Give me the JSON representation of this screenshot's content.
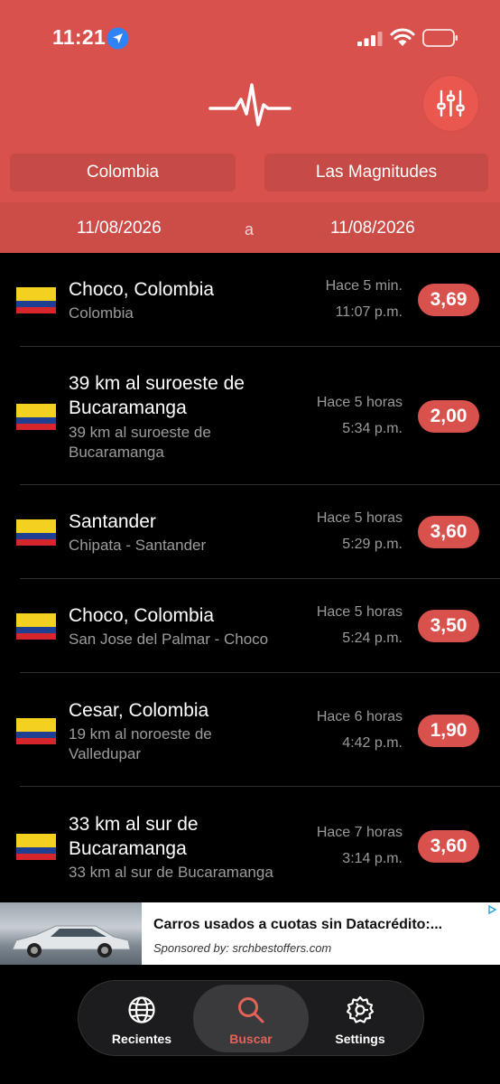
{
  "status_bar": {
    "time": "11:21"
  },
  "header": {
    "logo_icon": "heartbeat-icon",
    "filter_icon": "sliders-icon",
    "country_selector": "Colombia",
    "magnitude_selector": "Las Magnitudes",
    "date_from": "11/08/2026",
    "date_separator": "a",
    "date_to": "11/08/2026"
  },
  "earthquakes": [
    {
      "title": "Choco, Colombia",
      "subtitle": "Colombia",
      "ago": "Hace 5 min.",
      "time": "11:07 p.m.",
      "magnitude": "3,69"
    },
    {
      "title": "39 km al suroeste de Bucaramanga",
      "subtitle": "39 km al suroeste de Bucaramanga",
      "ago": "Hace 5 horas",
      "time": "5:34 p.m.",
      "magnitude": "2,00"
    },
    {
      "title": "Santander",
      "subtitle": "Chipata - Santander",
      "ago": "Hace 5 horas",
      "time": "5:29 p.m.",
      "magnitude": "3,60"
    },
    {
      "title": "Choco, Colombia",
      "subtitle": "San Jose del Palmar - Choco",
      "ago": "Hace 5 horas",
      "time": "5:24 p.m.",
      "magnitude": "3,50"
    },
    {
      "title": "Cesar, Colombia",
      "subtitle": "19 km al noroeste de Valledupar",
      "ago": "Hace 6 horas",
      "time": "4:42 p.m.",
      "magnitude": "1,90"
    },
    {
      "title": "33 km al sur de Bucaramanga",
      "subtitle": "33 km al sur de Bucaramanga",
      "ago": "Hace 7 horas",
      "time": "3:14 p.m.",
      "magnitude": "3,60"
    }
  ],
  "ad": {
    "title": "Carros usados a cuotas sin Datacrédito:...",
    "sponsor": "Sponsored by: srchbestoffers.com"
  },
  "tabbar": {
    "tabs": [
      {
        "label": "Recientes",
        "icon": "globe-icon",
        "active": false
      },
      {
        "label": "Buscar",
        "icon": "search-icon",
        "active": true
      },
      {
        "label": "Settings",
        "icon": "settings-icon",
        "active": false
      }
    ]
  },
  "colors": {
    "accent": "#d9514c",
    "flag_yellow": "#f4d11e",
    "flag_blue": "#1e3f92",
    "flag_red": "#d6262b"
  }
}
